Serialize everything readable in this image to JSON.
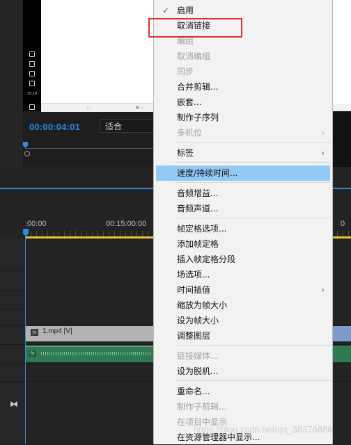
{
  "monitor": {
    "timecode": "00:00:04:01",
    "fit_select": "适合",
    "phone_time": "15:10"
  },
  "timeline": {
    "ruler_start": ":00:00",
    "ruler_mid": "00:15:00:00",
    "ruler_right": "0",
    "video_clip_label": "1.mp4 [V]",
    "fx_label": "fx"
  },
  "context_menu": {
    "items": [
      {
        "label": "启用",
        "checked": true,
        "disabled": false
      },
      {
        "label": "取消链接",
        "disabled": false
      },
      {
        "label": "编组",
        "disabled": true
      },
      {
        "label": "取消编组",
        "disabled": true
      },
      {
        "label": "同步",
        "disabled": true
      },
      {
        "label": "合并剪辑...",
        "disabled": false
      },
      {
        "label": "嵌套...",
        "disabled": false
      },
      {
        "label": "制作子序列",
        "disabled": false
      },
      {
        "label": "多机位",
        "disabled": true,
        "submenu": true
      },
      {
        "label": "标签",
        "disabled": false,
        "submenu": true
      },
      {
        "label": "速度/持续时间...",
        "disabled": false,
        "highlighted": true
      },
      {
        "label": "音频增益...",
        "disabled": false
      },
      {
        "label": "音频声道...",
        "disabled": false
      },
      {
        "label": "帧定格选项...",
        "disabled": false
      },
      {
        "label": "添加帧定格",
        "disabled": false
      },
      {
        "label": "插入帧定格分段",
        "disabled": false
      },
      {
        "label": "场选项...",
        "disabled": false
      },
      {
        "label": "时间插值",
        "disabled": false,
        "submenu": true
      },
      {
        "label": "缩放为帧大小",
        "disabled": false
      },
      {
        "label": "设为帧大小",
        "disabled": false
      },
      {
        "label": "调整图层",
        "disabled": false
      },
      {
        "label": "链接媒体...",
        "disabled": true
      },
      {
        "label": "设为脱机...",
        "disabled": false
      },
      {
        "label": "重命名...",
        "disabled": false
      },
      {
        "label": "制作子剪辑...",
        "disabled": true
      },
      {
        "label": "在项目中显示",
        "disabled": true
      },
      {
        "label": "在资源管理器中显示...",
        "disabled": false
      }
    ],
    "check_glyph": "✓",
    "submenu_glyph": "›"
  },
  "watermark": "https://blog.csdn.net/qq_38376686",
  "colors": {
    "accent_blue": "#2d8ceb",
    "highlight": "#91c9f7",
    "annotation_red": "#e0302b",
    "work_area_yellow": "#e7c52f"
  }
}
